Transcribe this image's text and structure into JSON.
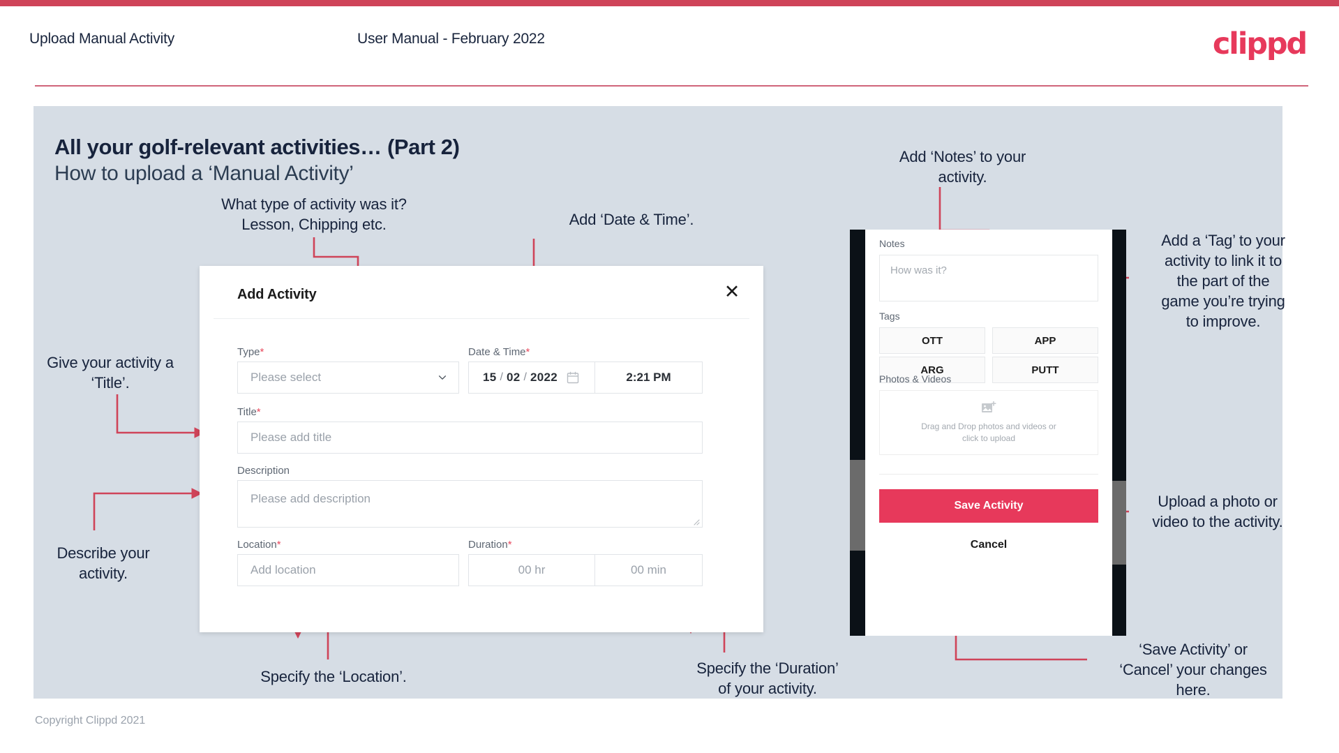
{
  "header": {
    "left_title": "Upload Manual Activity",
    "center_title": "User Manual - February 2022",
    "logo_text": "clippd",
    "accent_color": "#e7395b",
    "stripe_color": "#cf4459"
  },
  "slide": {
    "title_line1": "All your golf-relevant activities… (Part 2)",
    "title_line2": "How to upload a ‘Manual Activity’",
    "background_color": "#d6dde5"
  },
  "footer": {
    "copyright": "Copyright Clippd 2021"
  },
  "annotations": {
    "type_note": "What type of activity was it?\nLesson, Chipping etc.",
    "datetime_note": "Add ‘Date & Time’.",
    "title_note": "Give your activity a\n‘Title’.",
    "description_note": "Describe your\nactivity.",
    "location_note": "Specify the ‘Location’.",
    "duration_note": "Specify the ‘Duration’\nof your activity.",
    "notes_note": "Add ‘Notes’ to your\nactivity.",
    "tags_note": "Add a ‘Tag’ to your\nactivity to link it to\nthe part of the\ngame you’re trying\nto improve.",
    "photos_note": "Upload a photo or\nvideo to the activity.",
    "save_cancel_note": "‘Save Activity’ or\n‘Cancel’ your changes\nhere.",
    "arrow_color": "#cf4459"
  },
  "dialog": {
    "title": "Add Activity",
    "close_icon": "close-icon",
    "fields": {
      "type": {
        "label": "Type",
        "required_marker": "*",
        "placeholder": "Please select",
        "caret_icon": "chevron-down-icon"
      },
      "datetime": {
        "label": "Date & Time",
        "required_marker": "*",
        "day": "15",
        "month": "02",
        "year": "2022",
        "separator": "/",
        "calendar_icon": "calendar-icon",
        "time": "2:21 PM"
      },
      "title": {
        "label": "Title",
        "required_marker": "*",
        "placeholder": "Please add title"
      },
      "description": {
        "label": "Description",
        "required_marker": "",
        "placeholder": "Please add description"
      },
      "location": {
        "label": "Location",
        "required_marker": "*",
        "placeholder": "Add location"
      },
      "duration": {
        "label": "Duration",
        "required_marker": "*",
        "hours_placeholder": "00 hr",
        "minutes_placeholder": "00 min"
      }
    }
  },
  "phone": {
    "notes": {
      "label": "Notes",
      "placeholder": "How was it?"
    },
    "tags": {
      "label": "Tags",
      "items": [
        "OTT",
        "APP",
        "ARG",
        "PUTT"
      ]
    },
    "photos": {
      "label": "Photos & Videos",
      "icon": "add-image-icon",
      "dropzone_line1": "Drag and Drop photos and videos or",
      "dropzone_line2": "click to upload"
    },
    "save_label": "Save Activity",
    "cancel_label": "Cancel",
    "save_color": "#e7395b"
  }
}
